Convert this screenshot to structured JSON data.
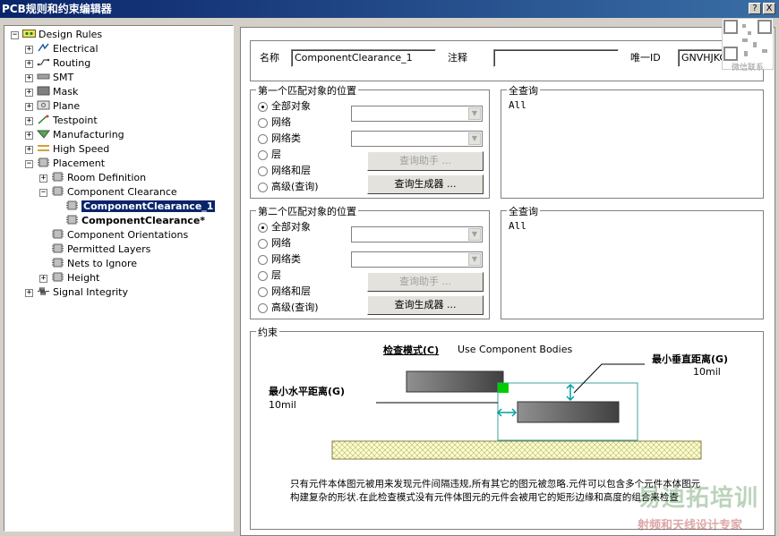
{
  "window": {
    "title": "PCB规则和约束编辑器",
    "help_btn": "?",
    "close_btn": "X"
  },
  "tree": {
    "root": "Design Rules",
    "items": [
      "Electrical",
      "Routing",
      "SMT",
      "Mask",
      "Plane",
      "Testpoint",
      "Manufacturing",
      "High Speed",
      "Placement"
    ],
    "placement_children": [
      "Room Definition",
      "Component Clearance",
      "Component Orientations",
      "Permitted Layers",
      "Nets to Ignore",
      "Height"
    ],
    "clearance_children": [
      "ComponentClearance_1",
      "ComponentClearance*"
    ],
    "last": "Signal Integrity"
  },
  "header": {
    "name_label": "名称",
    "name_value": "ComponentClearance_1",
    "comment_label": "注释",
    "comment_value": "",
    "id_label": "唯一ID",
    "id_value": "GNVHJKCE"
  },
  "match1": {
    "title": "第一个匹配对象的位置",
    "options": [
      "全部对象",
      "网络",
      "网络类",
      "层",
      "网络和层",
      "高级(查询)"
    ],
    "helper_btn": "查询助手 ...",
    "builder_btn": "查询生成器 ...",
    "query_title": "全查询",
    "query_value": "All"
  },
  "match2": {
    "title": "第二个匹配对象的位置",
    "options": [
      "全部对象",
      "网络",
      "网络类",
      "层",
      "网络和层",
      "高级(查询)"
    ],
    "helper_btn": "查询助手 ...",
    "builder_btn": "查询生成器 ...",
    "query_title": "全查询",
    "query_value": "All"
  },
  "constraints": {
    "title": "约束",
    "check_mode_label": "检查模式(C)",
    "check_mode_value": "Use Component Bodies",
    "vertical_label": "最小垂直距离(G)",
    "vertical_value": "10mil",
    "horizontal_label": "最小水平距离(G)",
    "horizontal_value": "10mil",
    "desc1": "只有元件本体图元被用来发现元件间隔违规,所有其它的图元被忽略.元件可以包含多个元件本体图元",
    "desc2": "构建复杂的形状.在此检查模式没有元件体图元的元件会被用它的矩形边缘和高度的组合来检查"
  },
  "watermark": {
    "line1": "易迪拓培训",
    "line2": "射频和天线设计专家",
    "qr_caption": "微信联系"
  },
  "colors": {
    "title_bar": "#0a246a",
    "selection": "#0a246a",
    "green_marker": "#00cc00"
  }
}
